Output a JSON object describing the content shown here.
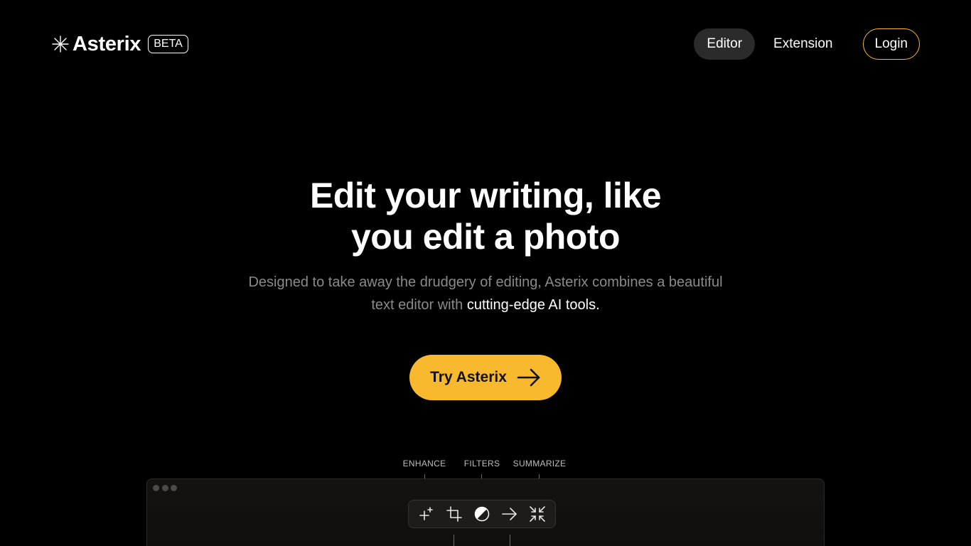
{
  "header": {
    "logo_text": "Asterix",
    "beta_label": "BETA",
    "nav": {
      "editor": "Editor",
      "extension": "Extension",
      "login": "Login"
    }
  },
  "hero": {
    "headline_line1": "Edit your writing, like",
    "headline_line2": "you edit a photo",
    "subtext_part1": "Designed to take away the drudgery of editing, Asterix combines a beautiful text editor with ",
    "subtext_highlight": "cutting-edge AI tools.",
    "cta_label": "Try Asterix"
  },
  "preview": {
    "labels": [
      "ENHANCE",
      "FILTERS",
      "SUMMARIZE"
    ],
    "tools": [
      "sparkle-icon",
      "crop-icon",
      "contrast-icon",
      "arrow-right-icon",
      "collapse-icon"
    ]
  },
  "colors": {
    "accent": "#f8b92f",
    "background": "#000000",
    "muted_text": "#8a8a8a",
    "nav_active_bg": "#2b2b2b"
  }
}
